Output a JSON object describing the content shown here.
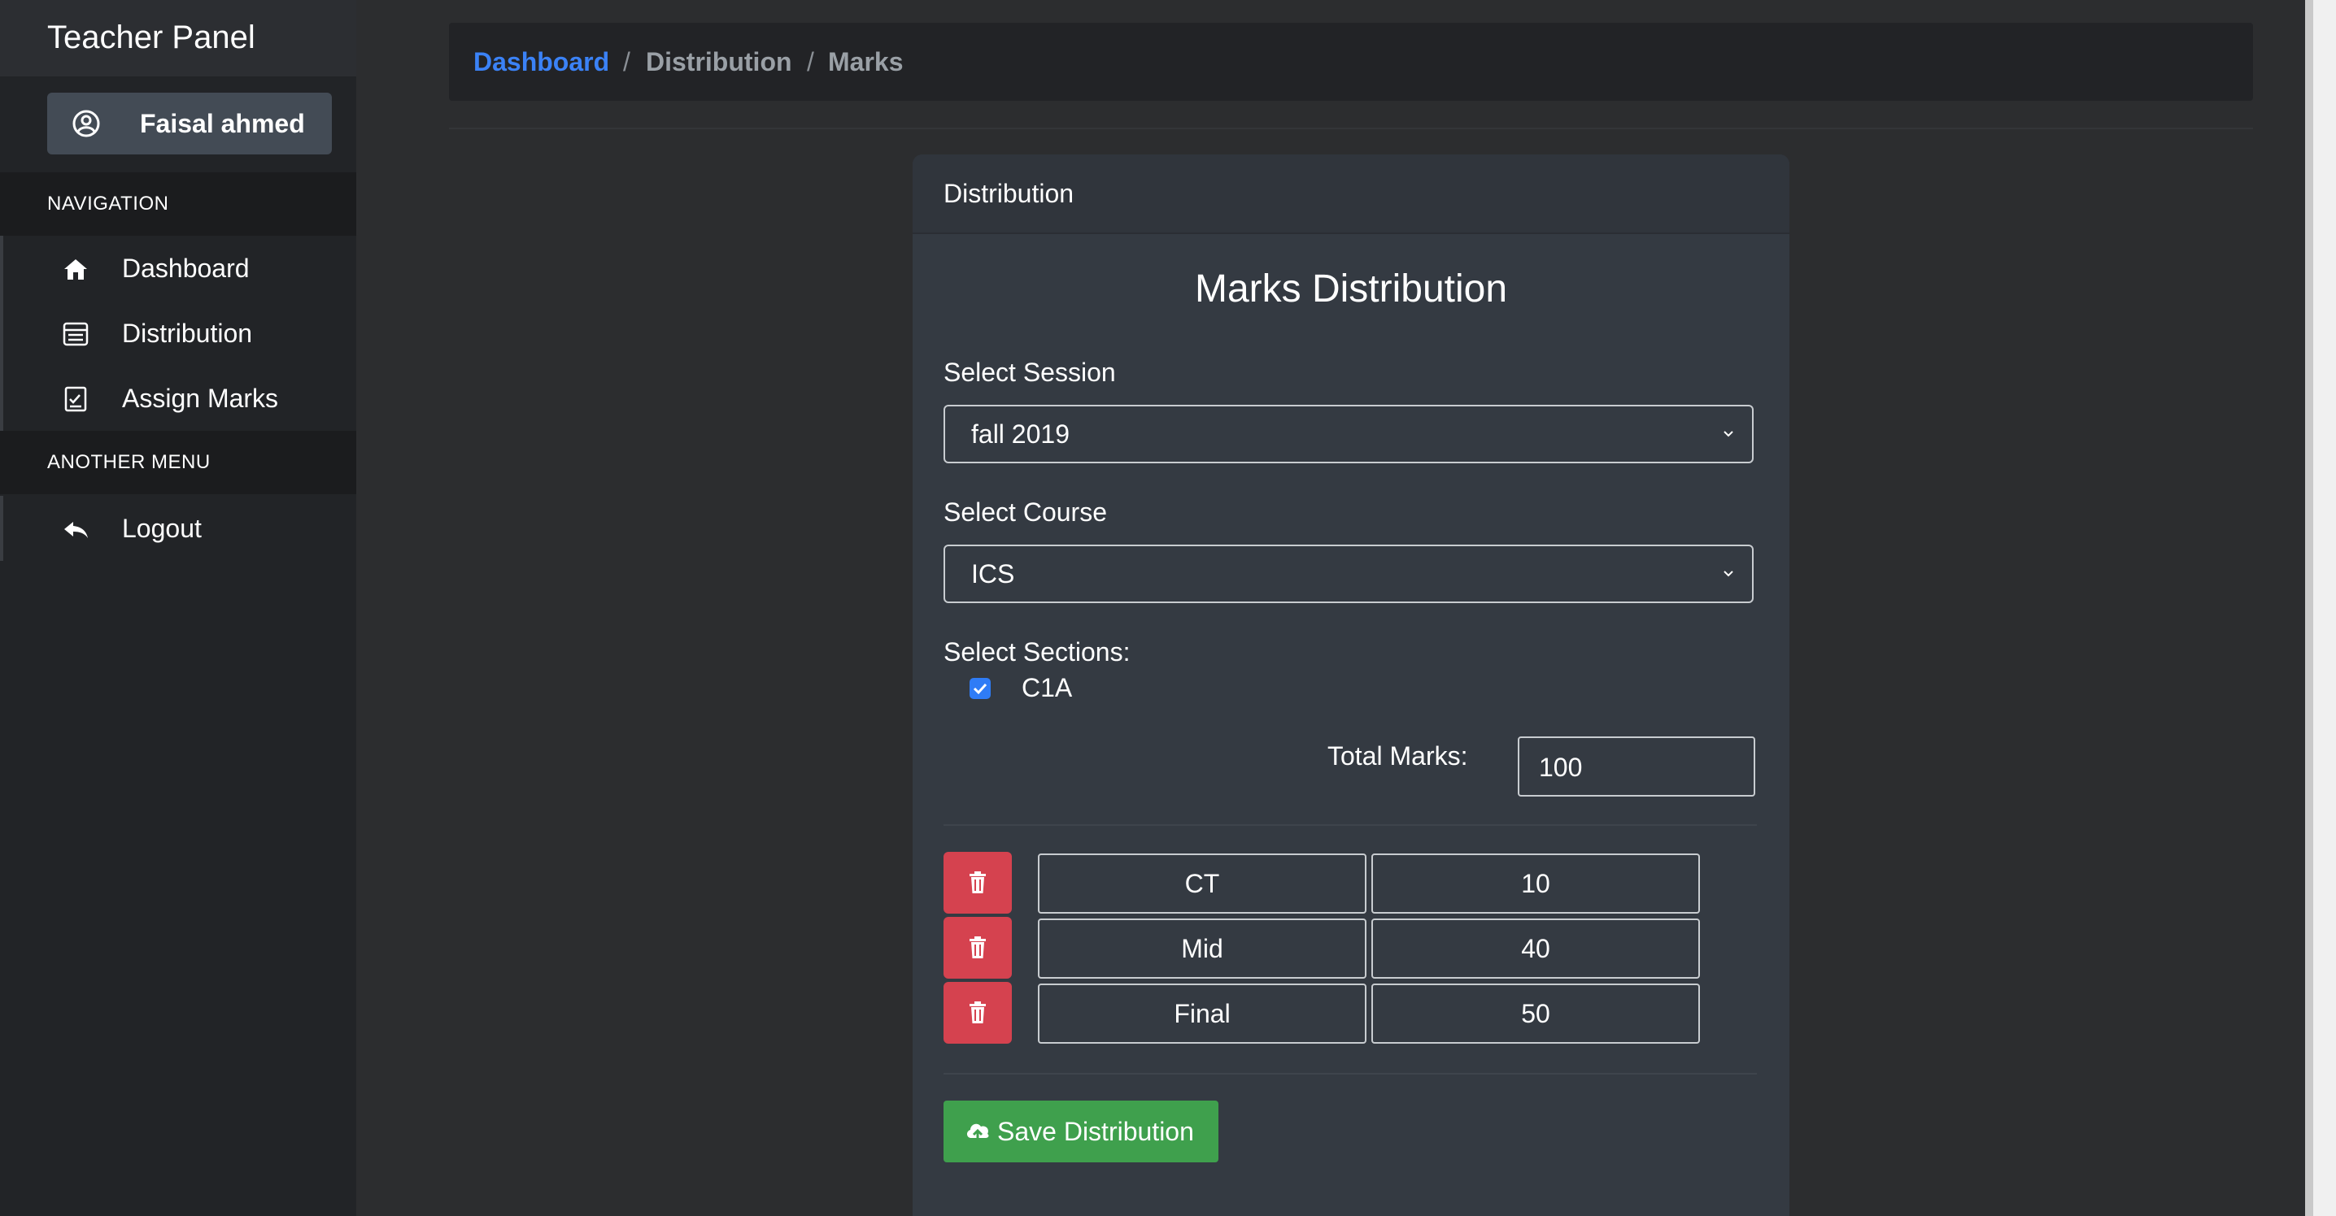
{
  "app": {
    "title": "Teacher Panel"
  },
  "user": {
    "name": "Faisal ahmed"
  },
  "sidebar": {
    "sections": [
      {
        "header": "NAVIGATION",
        "items": [
          {
            "label": "Dashboard",
            "icon": "home-icon"
          },
          {
            "label": "Distribution",
            "icon": "distribution-icon"
          },
          {
            "label": "Assign Marks",
            "icon": "assign-marks-icon"
          }
        ]
      },
      {
        "header": "ANOTHER MENU",
        "items": [
          {
            "label": "Logout",
            "icon": "logout-icon"
          }
        ]
      }
    ]
  },
  "breadcrumb": {
    "items": [
      "Dashboard",
      "Distribution",
      "Marks"
    ],
    "separator": "/"
  },
  "card": {
    "header": "Distribution",
    "title": "Marks Distribution",
    "session": {
      "label": "Select Session",
      "value": "fall 2019"
    },
    "course": {
      "label": "Select Course",
      "value": "ICS"
    },
    "sections": {
      "label": "Select Sections:",
      "options": [
        {
          "label": "C1A",
          "checked": true
        }
      ]
    },
    "total": {
      "label": "Total Marks:",
      "value": "100"
    },
    "rows": [
      {
        "name": "CT",
        "marks": "10"
      },
      {
        "name": "Mid",
        "marks": "40"
      },
      {
        "name": "Final",
        "marks": "50"
      }
    ],
    "save_label": "Save Distribution"
  },
  "colors": {
    "accent": "#3b82f6",
    "danger": "#d5424f",
    "success": "#3fa04d",
    "card": "#343a42",
    "sidebar": "#222427"
  }
}
